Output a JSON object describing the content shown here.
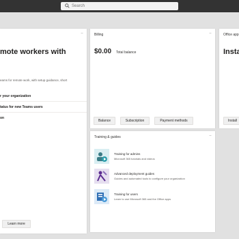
{
  "header": {
    "search_placeholder": "Search"
  },
  "left_card": {
    "heading": "mote workers with",
    "desc": "eams for remote work, with setup guidance, short",
    "items": [
      "r your organization",
      "tatus for new Teams users",
      "on"
    ],
    "learn_more": "Learn more"
  },
  "billing": {
    "title": "Billing",
    "amount": "$0.00",
    "amount_label": "Total balance",
    "buttons": [
      "Balance",
      "Subscription",
      "Payment methods"
    ]
  },
  "office_apps": {
    "title": "Office app",
    "heading": "Insta",
    "button": "Install"
  },
  "training": {
    "title": "Training & guides",
    "items": [
      {
        "title": "Training for admins",
        "subtitle": "Microsoft 365 tutorials and videos"
      },
      {
        "title": "Advanced deployment guides",
        "subtitle": "Guides and automated tools to configure your organization"
      },
      {
        "title": "Training for users",
        "subtitle": "Learn to use Microsoft 365 and the Office apps"
      }
    ]
  },
  "more_glyph": "···"
}
